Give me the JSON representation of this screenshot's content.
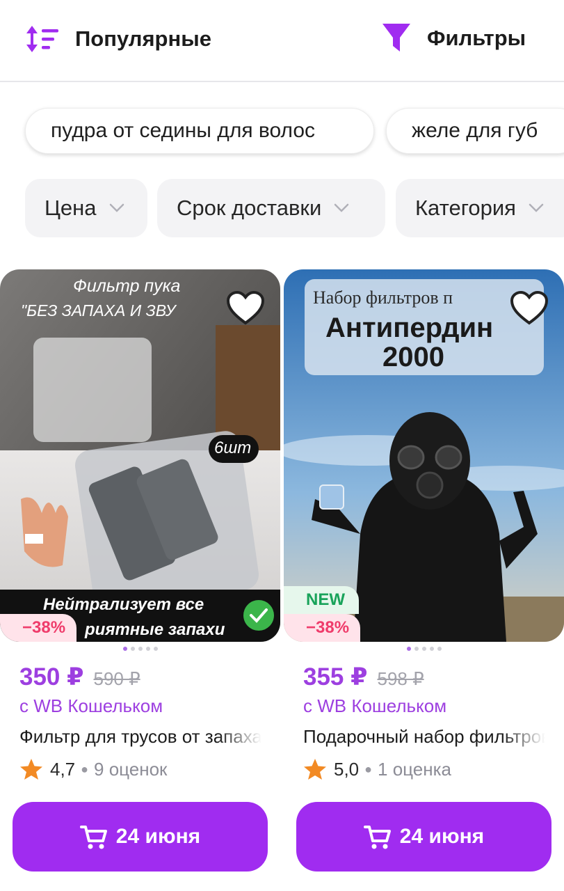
{
  "header": {
    "sort_label": "Популярные",
    "filters_label": "Фильтры"
  },
  "suggestions": [
    "пудра от седины для волос",
    "желе для губ"
  ],
  "filter_pills": [
    "Цена",
    "Срок доставки",
    "Категория"
  ],
  "colors": {
    "accent": "#a02cf0",
    "price": "#9d3fe0",
    "discount_text": "#ef3c6b",
    "new_text": "#19a35a"
  },
  "products": [
    {
      "image_text": {
        "title_line1": "Фильтр пука",
        "title_line2": "\"БЕЗ ЗАПАХА И ЗВУ",
        "count": "6шт",
        "bottom_line1": "Нейтрализует все",
        "bottom_line2": "риятные запахи"
      },
      "discount": "−38%",
      "image_index": 1,
      "image_count": 5,
      "price": "350 ₽",
      "old_price": "590 ₽",
      "wallet_text": "с WB Кошельком",
      "title": "Фильтр для трусов от запаха",
      "rating": "4,7",
      "reviews": "9 оценок",
      "delivery": "24 июня"
    },
    {
      "image_text": {
        "title_line1": "Набор фильтров п",
        "title_line2": "Антипердин",
        "title_line3": "2000"
      },
      "new_badge": "NEW",
      "discount": "−38%",
      "image_index": 1,
      "image_count": 5,
      "price": "355 ₽",
      "old_price": "598 ₽",
      "wallet_text": "с WB Кошельком",
      "title": "Подарочный набор фильтров",
      "rating": "5,0",
      "reviews": "1 оценка",
      "delivery": "24 июня"
    }
  ]
}
